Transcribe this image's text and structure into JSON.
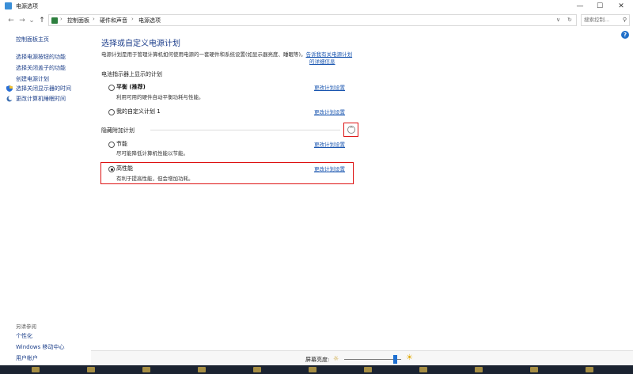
{
  "window": {
    "title": "电源选项",
    "minimize": "—",
    "maximize": "☐",
    "close": "✕"
  },
  "nav": {
    "back": "←",
    "forward": "→",
    "recent": "⌄",
    "up": "↑",
    "dropdown": "∨",
    "refresh": "↻"
  },
  "address": {
    "crumbs": [
      "控制面板",
      "硬件和声音",
      "电源选项"
    ],
    "sep": "›",
    "lead": "›"
  },
  "search": {
    "placeholder": "搜索控制...",
    "icon": "⚲"
  },
  "help": "?",
  "sidebar": {
    "home": "控制面板主页",
    "items": [
      "选择电源按钮的功能",
      "选择关闭盖子的功能",
      "创建电源计划",
      "选择关闭显示器的时间",
      "更改计算机睡眠时间"
    ],
    "see_also_title": "另请参阅",
    "see_also": [
      "个性化",
      "Windows 移动中心",
      "用户帐户"
    ]
  },
  "main": {
    "heading": "选择或自定义电源计划",
    "description": "电源计划是用于管理计算机如何使用电源的一套硬件和系统设置(如显示器亮度、睡眠等)。",
    "description_link_1": "告诉我有关电源计划",
    "description_link_2": "的详细信息",
    "battery_group": "电池指示器上显示的计划",
    "hidden_group": "隐藏附加计划",
    "collapse_icon": "^",
    "plans": [
      {
        "name": "平衡 (推荐)",
        "desc": "利用可用的硬件自动平衡功耗与性能。",
        "change": "更改计划设置",
        "selected": false
      },
      {
        "name": "我的自定义计划 1",
        "desc": "",
        "change": "更改计划设置",
        "selected": false
      },
      {
        "name": "节能",
        "desc": "尽可能降低计算机性能以节能。",
        "change": "更改计划设置",
        "selected": false
      },
      {
        "name": "高性能",
        "desc": "有利于提高性能，但会增加功耗。",
        "change": "更改计划设置",
        "selected": true
      }
    ]
  },
  "bottom": {
    "brightness_label": "屏幕亮度:",
    "brightness_value": 0.9,
    "dim_icon": "☼",
    "bright_icon": "☀"
  },
  "colors": {
    "link": "#1a56b0",
    "heading": "#1e3f8c",
    "highlight": "#d11111",
    "accent": "#1e6fd1"
  }
}
